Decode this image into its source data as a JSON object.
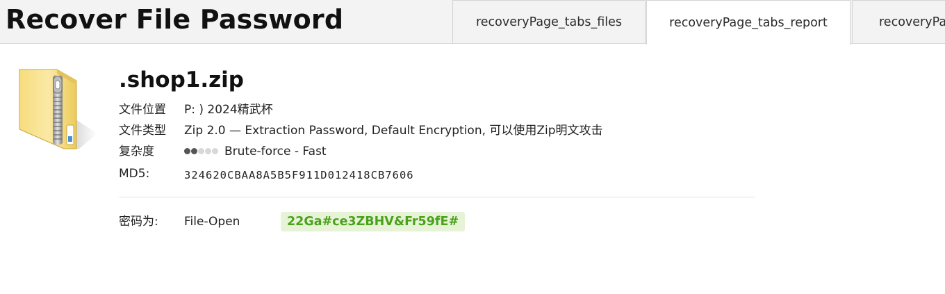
{
  "header": {
    "title": "Recover File Password",
    "tabs": [
      {
        "label": "recoveryPage_tabs_files",
        "active": false
      },
      {
        "label": "recoveryPage_tabs_report",
        "active": true
      },
      {
        "label": "recoveryPage_tabs_",
        "active": false
      }
    ]
  },
  "file": {
    "icon": "zip-folder-icon",
    "name": ".shop1.zip",
    "details": {
      "location_label": "文件位置",
      "location_value": "P: ) 2024精武杯",
      "type_label": "文件类型",
      "type_value": "Zip 2.0 — Extraction Password, Default Encryption, 可以使用Zip明文攻击",
      "complexity_label": "复杂度",
      "complexity_level": 2,
      "complexity_max": 5,
      "complexity_value": "Brute-force - Fast",
      "md5_label": "MD5:",
      "md5_value": "324620CBAA8A5B5F911D012418CB7606"
    }
  },
  "result": {
    "label": "密码为:",
    "password_type": "File-Open",
    "password": "22Ga#ce3ZBHV&Fr59fE#"
  },
  "colors": {
    "password_text": "#4aa21a",
    "password_bg": "#e6f3d6",
    "header_bg": "#f3f3f3"
  }
}
